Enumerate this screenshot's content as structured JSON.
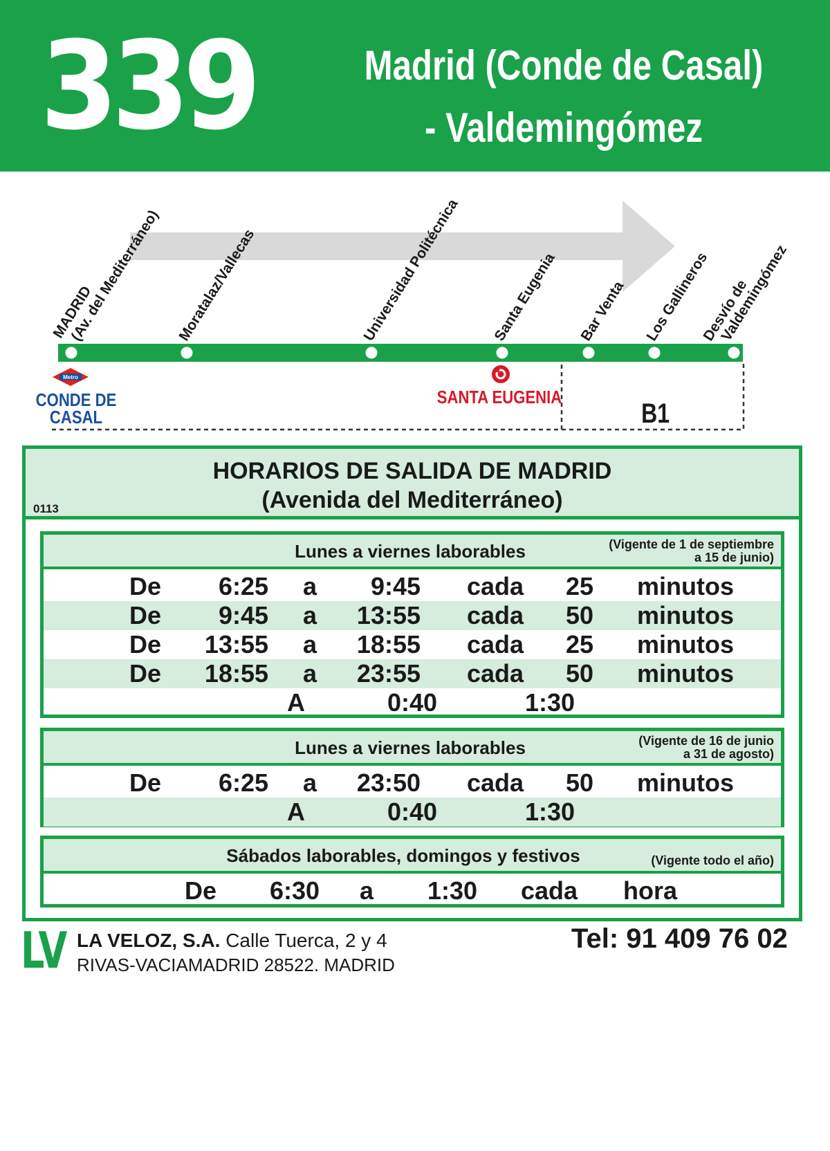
{
  "header": {
    "route_number": "339",
    "title_line1": "Madrid (Conde de Casal)",
    "title_line2": "- Valdemingómez"
  },
  "route_map": {
    "stops": [
      {
        "name_line1": "MADRID",
        "name_line2": "(Av. del Mediterráneo)"
      },
      {
        "name_line1": "Moratalaz/Vallecas",
        "name_line2": ""
      },
      {
        "name_line1": "Universidad Politécnica",
        "name_line2": ""
      },
      {
        "name_line1": "Santa Eugenia",
        "name_line2": ""
      },
      {
        "name_line1": "Bar Venta",
        "name_line2": ""
      },
      {
        "name_line1": "Los Gallineros",
        "name_line2": ""
      },
      {
        "name_line1": "Desvío de",
        "name_line2": "Valdemingómez"
      }
    ],
    "metro_badge": "Metro",
    "metro_station_line1": "CONDE DE",
    "metro_station_line2": "CASAL",
    "train_station": "SANTA EUGENIA",
    "zone": "B1",
    "colors": {
      "line": "#1aa14a",
      "metro": "#e2231a",
      "metro_text": "#1d4f9c",
      "train": "#d7192a",
      "arrow": "#d9d9d9"
    }
  },
  "schedule": {
    "code": "0113",
    "title_line1": "HORARIOS DE SALIDA DE MADRID",
    "title_line2": "(Avenida del Mediterráneo)",
    "blocks": [
      {
        "title": "Lunes a viernes laborables",
        "note_line1": "(Vigente de 1 de septiembre",
        "note_line2": "a 15 de junio)",
        "rows": [
          {
            "de": "De",
            "from": "6:25",
            "a": "a",
            "to": "9:45",
            "cada": "cada",
            "every": "25",
            "unit": "minutos"
          },
          {
            "de": "De",
            "from": "9:45",
            "a": "a",
            "to": "13:55",
            "cada": "cada",
            "every": "50",
            "unit": "minutos"
          },
          {
            "de": "De",
            "from": "13:55",
            "a": "a",
            "to": "18:55",
            "cada": "cada",
            "every": "25",
            "unit": "minutos"
          },
          {
            "de": "De",
            "from": "18:55",
            "a": "a",
            "to": "23:55",
            "cada": "cada",
            "every": "50",
            "unit": "minutos"
          }
        ],
        "extra": {
          "label": "A",
          "t1": "0:40",
          "t2": "1:30"
        }
      },
      {
        "title": "Lunes a viernes laborables",
        "note_line1": "(Vigente de 16 de junio",
        "note_line2": "a 31 de agosto)",
        "rows": [
          {
            "de": "De",
            "from": "6:25",
            "a": "a",
            "to": "23:50",
            "cada": "cada",
            "every": "50",
            "unit": "minutos"
          }
        ],
        "extra": {
          "label": "A",
          "t1": "0:40",
          "t2": "1:30"
        }
      },
      {
        "title": "Sábados laborables, domingos y festivos",
        "note_line1": "(Vigente todo el año)",
        "rows": [
          {
            "de": "De",
            "from": "6:30",
            "a": "a",
            "to": "1:30",
            "cada": "cada",
            "unit": "hora"
          }
        ]
      }
    ]
  },
  "footer": {
    "logo": "LV",
    "company": "LA VELOZ, S.A.",
    "address1": "Calle Tuerca, 2 y 4",
    "address2": "RIVAS-VACIAMADRID 28522. MADRID",
    "phone": "Tel: 91 409 76 02"
  }
}
